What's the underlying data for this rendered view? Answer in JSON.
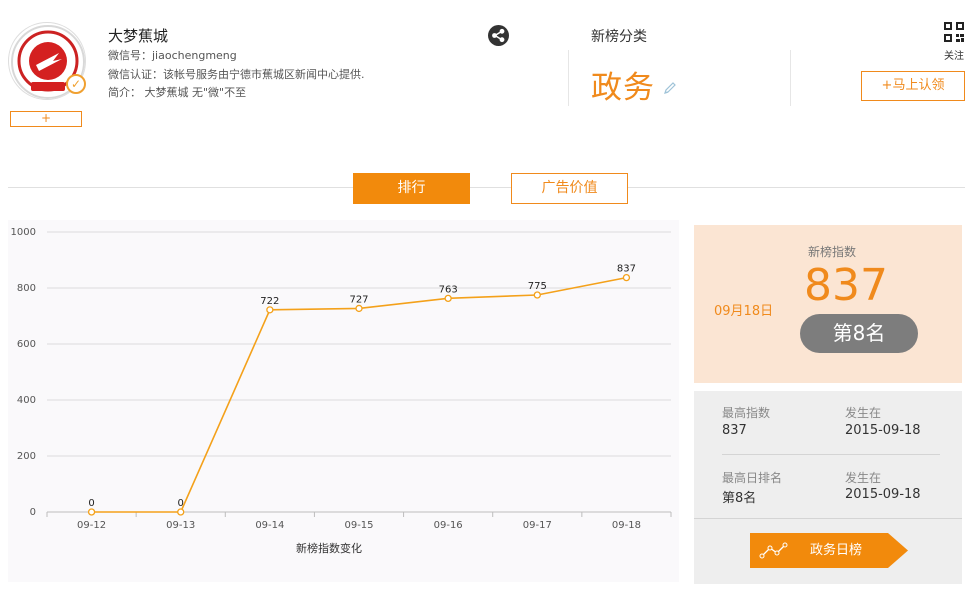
{
  "account": {
    "name": "大梦蕉城",
    "wechat_id": "微信号：jiaochengmeng",
    "certification": "微信认证：该帐号服务由宁德市蕉城区新闻中心提供.",
    "intro": "简介： 大梦蕉城 无\"微\"不至",
    "follow_label": "+"
  },
  "category": {
    "title": "新榜分类",
    "value": "政务"
  },
  "qr": {
    "label": "关注"
  },
  "claim_label": "+马上认领",
  "tabs": [
    {
      "label": "排行",
      "active": true
    },
    {
      "label": "广告价值",
      "active": false
    }
  ],
  "chart_data": {
    "type": "line",
    "x": [
      "09-12",
      "09-13",
      "09-14",
      "09-15",
      "09-16",
      "09-17",
      "09-18"
    ],
    "series": [
      {
        "values": [
          0,
          0,
          722,
          727,
          763,
          775,
          837
        ],
        "color": "#f4a11a"
      }
    ],
    "data_labels": [
      "0",
      "0",
      "722",
      "727",
      "763",
      "775",
      "837"
    ],
    "ylim": [
      0,
      1000
    ],
    "yticks": [
      "0",
      "200",
      "400",
      "600",
      "800",
      "1000"
    ],
    "xlabel": "新榜指数变化",
    "ylabel": "",
    "grid": true
  },
  "index_panel": {
    "date": "09月18日",
    "label": "新榜指数",
    "value": "837",
    "rank": "第8名"
  },
  "stats": {
    "max_index_label": "最高指数",
    "max_index_value": "837",
    "max_index_when_label": "发生在",
    "max_index_when": "2015-09-18",
    "max_rank_label": "最高日排名",
    "max_rank_value": "第8名",
    "max_rank_when_label": "发生在",
    "max_rank_when": "2015-09-18"
  },
  "daily_button": {
    "label": "政务日榜"
  },
  "colors": {
    "accent": "#f08a1c",
    "line": "#f4a11a",
    "panel_peach": "#fbe5d3",
    "panel_grey": "#eeeeee"
  }
}
